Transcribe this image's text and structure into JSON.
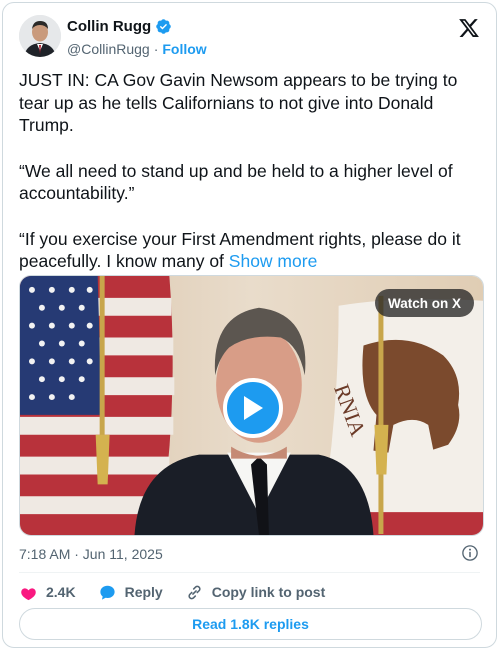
{
  "author": {
    "name": "Collin Rugg",
    "handle": "@CollinRugg",
    "separator": "·",
    "follow_label": "Follow"
  },
  "tweet": {
    "paragraphs": [
      "JUST IN: CA Gov Gavin Newsom appears to be trying to tear up as he tells Californians to not give into Donald Trump.",
      "“We all need to stand up and be held to a higher level of accountability.”",
      "“If you exercise your First Amendment rights, please do it peacefully. I know many of"
    ],
    "show_more_label": "Show more"
  },
  "video": {
    "watch_label": "Watch on X",
    "flag_text": "RNIA"
  },
  "meta": {
    "timestamp": "7:18 AM · Jun 11, 2025"
  },
  "actions": {
    "likes": "2.4K",
    "reply_label": "Reply",
    "copy_label": "Copy link to post"
  },
  "replies_button_label": "Read 1.8K replies",
  "colors": {
    "accent": "#1d9bf0",
    "like": "#f91880",
    "text": "#0f1419",
    "secondary": "#536471"
  }
}
